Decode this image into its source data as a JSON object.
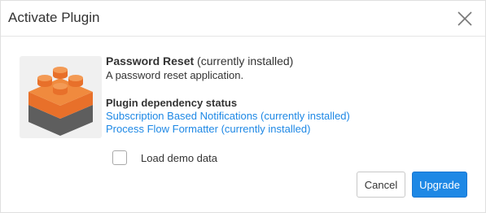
{
  "dialog": {
    "title": "Activate Plugin"
  },
  "plugin": {
    "name": "Password Reset",
    "status": " (currently installed)",
    "description": "A password reset application.",
    "icon": "lego-brick-icon",
    "colors": {
      "orange": "#e8702a",
      "gray": "#5e5e5e",
      "tile": "#f0f0f0"
    }
  },
  "dependencies": {
    "title": "Plugin dependency status",
    "items": [
      "Subscription Based Notifications (currently installed)",
      "Process Flow Formatter (currently installed)"
    ]
  },
  "demo": {
    "label": "Load demo data",
    "checked": false
  },
  "buttons": {
    "cancel": "Cancel",
    "upgrade": "Upgrade"
  },
  "colors": {
    "accent": "#1e88e5",
    "link": "#1e88e5"
  }
}
